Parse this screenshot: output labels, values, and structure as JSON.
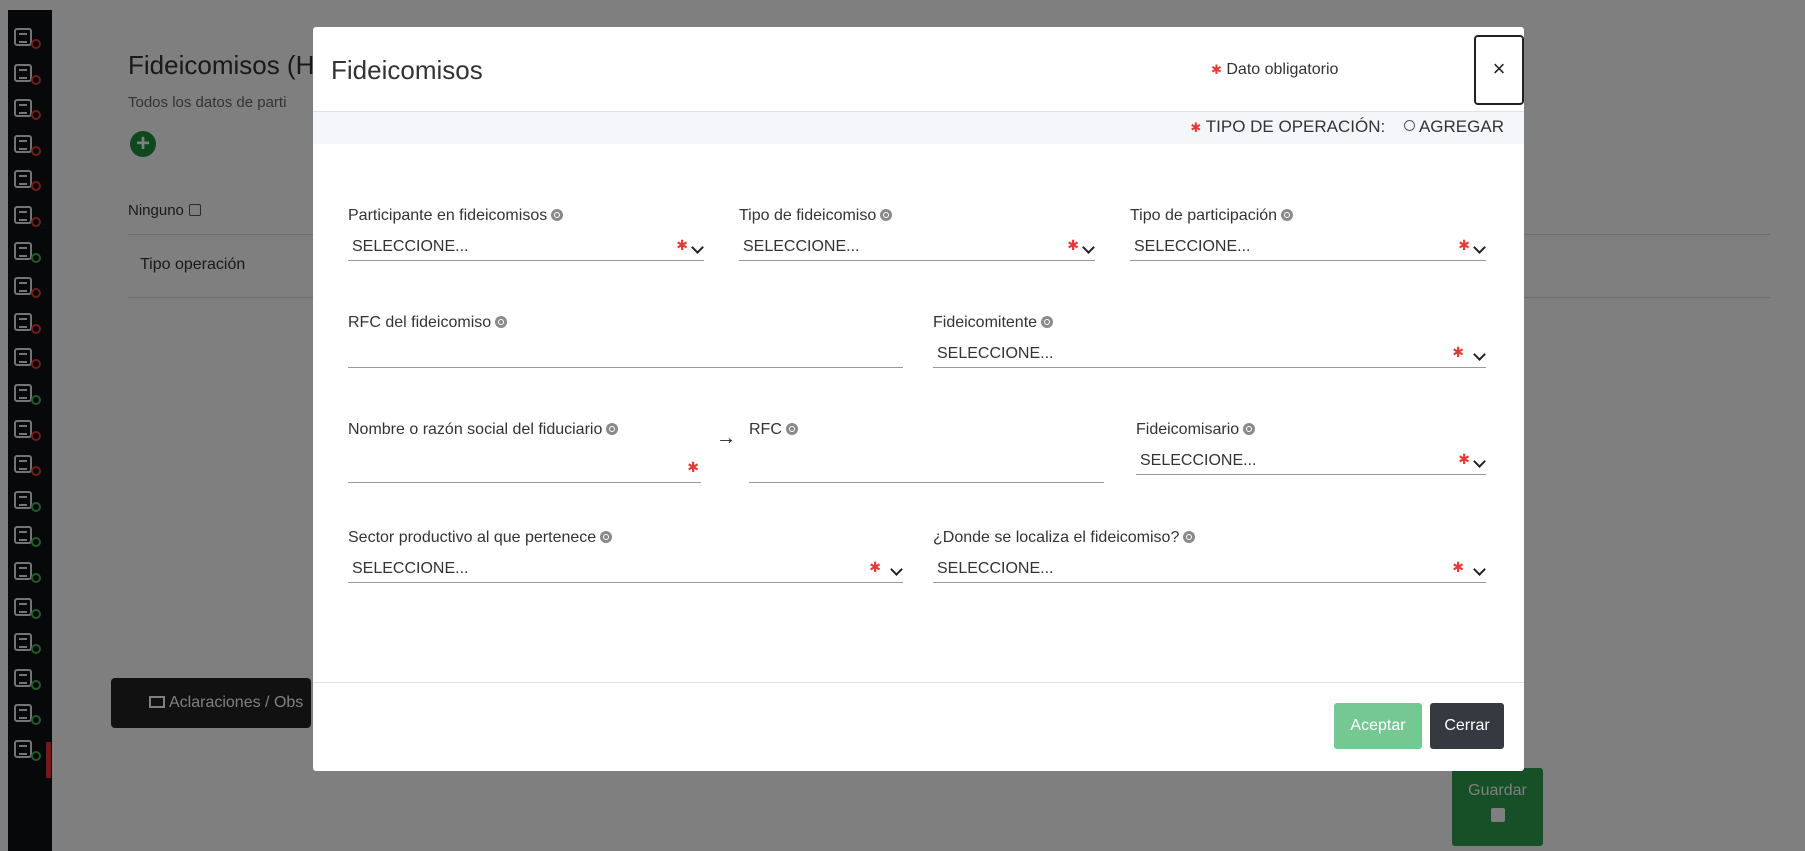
{
  "background": {
    "title": "Fideicomisos (H",
    "subtitle": "Todos los datos de parti",
    "ninguno_label": "Ninguno",
    "column_header": "Tipo operación",
    "aclaraciones_label": "Aclaraciones / Obs",
    "guardar_label": "Guardar"
  },
  "sidebar": {
    "icons": [
      {
        "name": "declaration-icon",
        "status": "error"
      },
      {
        "name": "home-upload-icon",
        "status": "error"
      },
      {
        "name": "document-icon",
        "status": "error"
      },
      {
        "name": "building-icon",
        "status": "error"
      },
      {
        "name": "people-icon",
        "status": "error"
      },
      {
        "name": "group-icon",
        "status": "error"
      },
      {
        "name": "form-icon",
        "status": "ok"
      },
      {
        "name": "portfolio-icon",
        "status": "error"
      },
      {
        "name": "house-icon",
        "status": "error"
      },
      {
        "name": "car-icon",
        "status": "error"
      },
      {
        "name": "chart-icon",
        "status": "ok"
      },
      {
        "name": "handshake-icon",
        "status": "error"
      },
      {
        "name": "bank-card-icon",
        "status": "error"
      },
      {
        "name": "house-settings-icon",
        "status": "ok"
      },
      {
        "name": "pie-chart-icon",
        "status": "ok"
      },
      {
        "name": "network-icon",
        "status": "ok"
      },
      {
        "name": "institution-icon",
        "status": "ok"
      },
      {
        "name": "org-icon",
        "status": "ok"
      },
      {
        "name": "stats-icon",
        "status": "ok"
      },
      {
        "name": "user-badge-icon",
        "status": "ok"
      },
      {
        "name": "checklist-icon",
        "status": "ok"
      }
    ],
    "error_color": "#e53935",
    "ok_color": "#3fb950"
  },
  "modal": {
    "title": "Fideicomisos",
    "required_note": "Dato obligatorio",
    "close_symbol": "×",
    "operation_label": "TIPO DE OPERACIÓN:",
    "operation_option": "AGREGAR",
    "fields": {
      "participante": {
        "label": "Participante en fideicomisos",
        "value": "SELECCIONE..."
      },
      "tipo_fideicomiso": {
        "label": "Tipo de fideicomiso",
        "value": "SELECCIONE..."
      },
      "tipo_participacion": {
        "label": "Tipo de participación",
        "value": "SELECCIONE..."
      },
      "rfc_fideicomiso": {
        "label": "RFC del fideicomiso",
        "value": ""
      },
      "fideicomitente": {
        "label": "Fideicomitente",
        "value": "SELECCIONE..."
      },
      "nombre_fiduciario": {
        "label": "Nombre o razón social del fiduciario",
        "value": ""
      },
      "rfc_fiduciario": {
        "label": "RFC",
        "value": ""
      },
      "fideicomisario": {
        "label": "Fideicomisario",
        "value": "SELECCIONE..."
      },
      "sector": {
        "label": "Sector productivo al que pertenece",
        "value": "SELECCIONE..."
      },
      "localizacion": {
        "label": "¿Donde se localiza el fideicomiso?",
        "value": "SELECCIONE..."
      }
    },
    "arrow_symbol": "→",
    "accept_label": "Aceptar",
    "close_label": "Cerrar",
    "accept_color": "#76c893",
    "close_color": "#343a40"
  }
}
